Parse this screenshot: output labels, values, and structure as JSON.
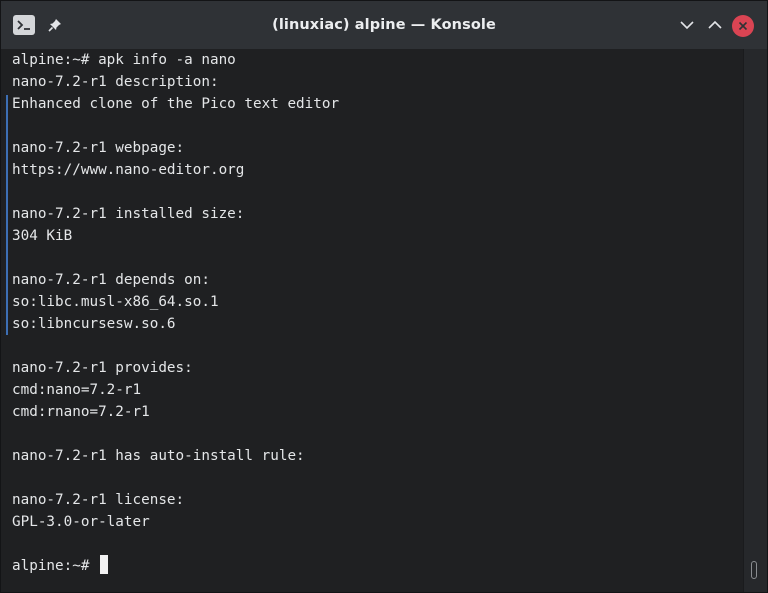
{
  "window": {
    "title": "(linuxiac) alpine — Konsole"
  },
  "titlebar": {
    "icons": {
      "app": "terminal-icon",
      "pin": "pin-icon",
      "minimize": "chevron-down-icon",
      "maximize": "chevron-up-icon",
      "close": "close-icon"
    },
    "close_color": "#da4453"
  },
  "terminal": {
    "lines": [
      "alpine:~# apk info -a nano",
      "nano-7.2-r1 description:",
      "Enhanced clone of the Pico text editor",
      "",
      "nano-7.2-r1 webpage:",
      "https://www.nano-editor.org",
      "",
      "nano-7.2-r1 installed size:",
      "304 KiB",
      "",
      "nano-7.2-r1 depends on:",
      "so:libc.musl-x86_64.so.1",
      "so:libncursesw.so.6",
      "",
      "nano-7.2-r1 provides:",
      "cmd:nano=7.2-r1",
      "cmd:rnano=7.2-r1",
      "",
      "nano-7.2-r1 has auto-install rule:",
      "",
      "nano-7.2-r1 license:",
      "GPL-3.0-or-later",
      "",
      "alpine:~# "
    ],
    "accent_marker_color": "#3d6fb4"
  }
}
